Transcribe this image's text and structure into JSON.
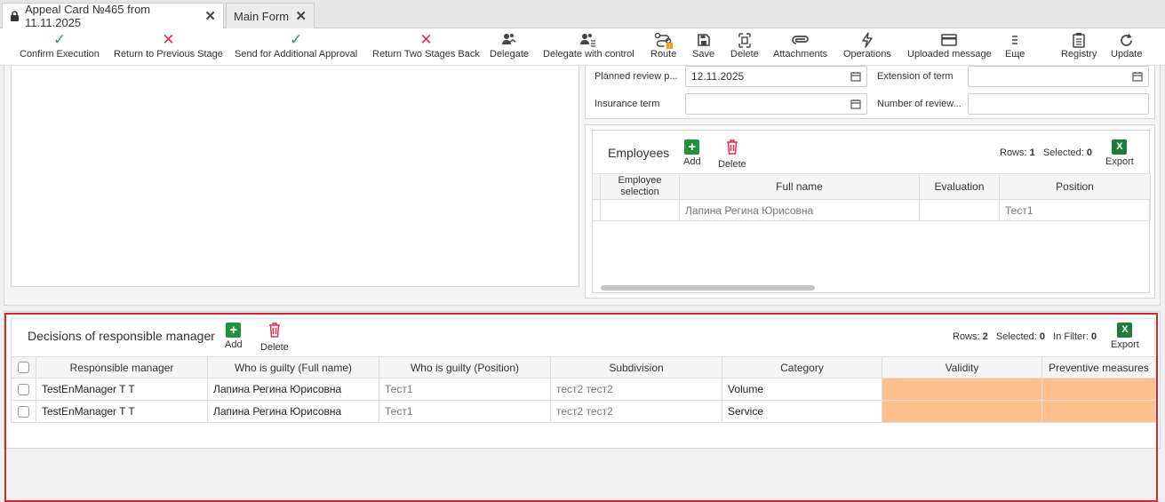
{
  "tabs": [
    {
      "label": "Appeal Card №465 from 11.11.2025",
      "active": true
    },
    {
      "label": "Main Form",
      "active": false
    }
  ],
  "toolbar": {
    "confirm_execution": "Confirm Execution",
    "return_previous": "Return to Previous Stage",
    "send_additional": "Send for Additional Approval",
    "return_two": "Return Two Stages Back",
    "delegate": "Delegate",
    "delegate_control": "Delegate with control",
    "route": "Route",
    "save": "Save",
    "delete": "Delete",
    "attachments": "Attachments",
    "operations": "Operations",
    "uploaded_message": "Uploaded message",
    "more": "Еще",
    "registry": "Registry",
    "update": "Update"
  },
  "fields": {
    "planned_review_label": "Planned review p...",
    "planned_review_value": "12.11.2025",
    "extension_label": "Extension of term",
    "extension_value": "",
    "insurance_label": "Insurance term",
    "insurance_value": "",
    "number_review_label": "Number of review...",
    "number_review_value": ""
  },
  "employees": {
    "title": "Employees",
    "add": "Add",
    "delete": "Delete",
    "rows_label": "Rows:",
    "rows": "1",
    "selected_label": "Selected:",
    "selected": "0",
    "export": "Export",
    "headers": {
      "selection": "Employee selection",
      "full_name": "Full name",
      "evaluation": "Evaluation",
      "position": "Position"
    },
    "rows_data": [
      {
        "selection": "",
        "full_name": "Лапина Регина Юрисовна",
        "evaluation": "",
        "position": "Тест1"
      }
    ]
  },
  "decisions": {
    "title": "Decisions of responsible manager",
    "add": "Add",
    "delete": "Delete",
    "rows_label": "Rows:",
    "rows": "2",
    "selected_label": "Selected:",
    "selected": "0",
    "filter_label": "In Filter:",
    "in_filter": "0",
    "export": "Export",
    "headers": {
      "manager": "Responsible manager",
      "guilty_name": "Who is guilty (Full name)",
      "guilty_position": "Who is guilty (Position)",
      "subdivision": "Subdivision",
      "category": "Category",
      "validity": "Validity",
      "preventive": "Preventive measures"
    },
    "rows_data": [
      {
        "manager": "TestEnManager T T",
        "guilty_name": "Лапина Регина Юрисовна",
        "guilty_position": "Тест1",
        "subdivision": "тест2 тест2",
        "category": "Volume"
      },
      {
        "manager": "TestEnManager T T",
        "guilty_name": "Лапина Регина Юрисовна",
        "guilty_position": "Тест1",
        "subdivision": "тест2 тест2",
        "category": "Service"
      }
    ]
  },
  "colors": {
    "green": "#2e9e52",
    "red": "#d9324a",
    "highlight": "#d62631",
    "required_cell": "#fec08f"
  }
}
